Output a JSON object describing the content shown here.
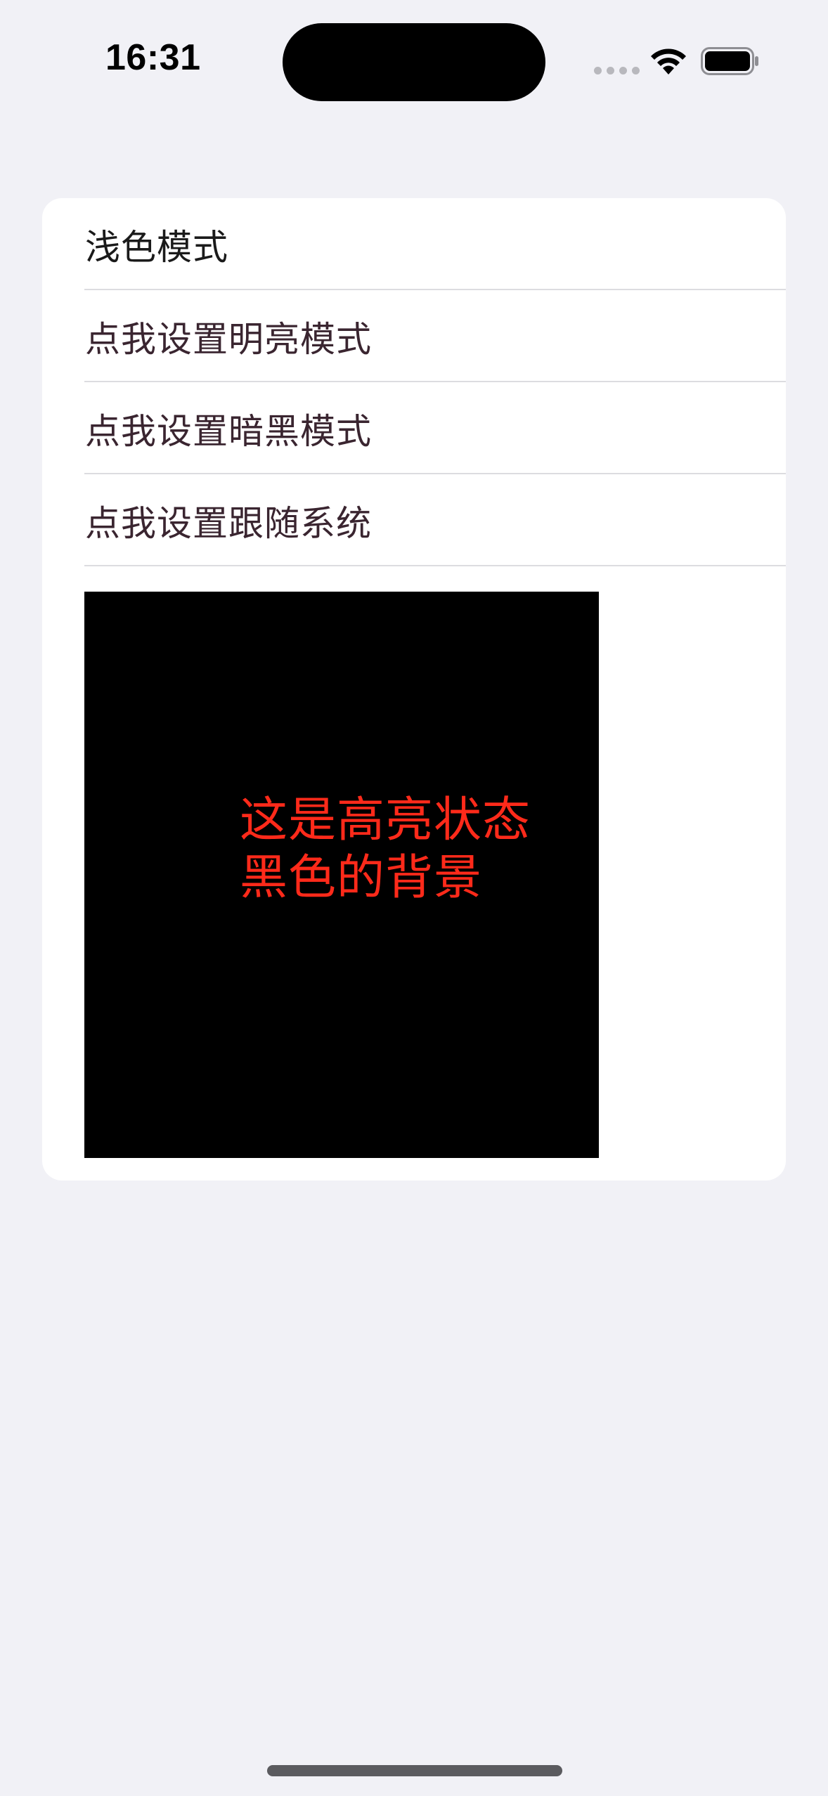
{
  "status_bar": {
    "time": "16:31",
    "icons": [
      "signal-dots-icon",
      "wifi-icon",
      "battery-icon"
    ]
  },
  "list": {
    "header": "浅色模式",
    "items": [
      {
        "label": "点我设置明亮模式"
      },
      {
        "label": "点我设置暗黑模式"
      },
      {
        "label": "点我设置跟随系统"
      }
    ]
  },
  "preview": {
    "line1": "这是高亮状态",
    "line2": "黑色的背景",
    "text_color": "#ff2a1a",
    "background_color": "#000000"
  },
  "colors": {
    "page_background": "#f1f1f6",
    "card_background": "#ffffff",
    "separator": "#dcdce0"
  }
}
